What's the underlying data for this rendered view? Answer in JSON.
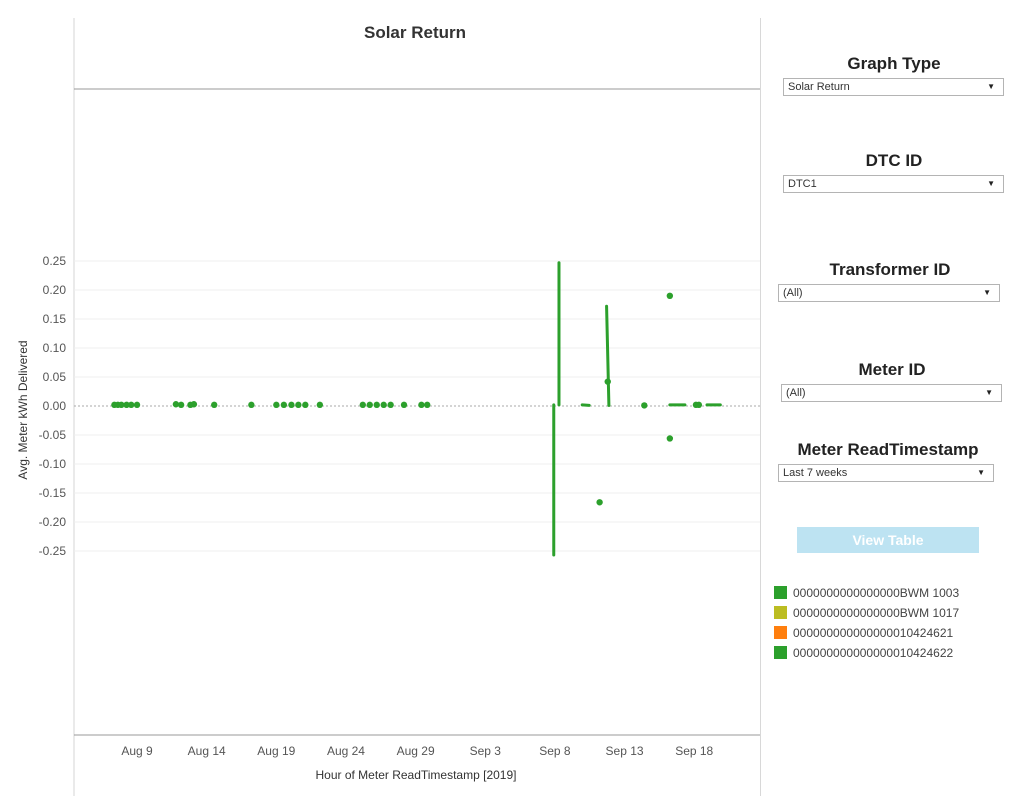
{
  "chart_data": {
    "type": "scatter",
    "title": "Solar Return",
    "xlabel": "Hour of Meter ReadTimestamp [2019]",
    "ylabel": "Avg. Meter kWh Delivered",
    "ylim": [
      -0.27,
      0.27
    ],
    "xlim": [
      "2019-08-05",
      "2019-09-23"
    ],
    "y_ticks": [
      "0.25",
      "0.20",
      "0.15",
      "0.10",
      "0.05",
      "0.00",
      "-0.05",
      "-0.10",
      "-0.15",
      "-0.20",
      "-0.25"
    ],
    "x_ticks": [
      {
        "label": "Aug 9",
        "date": "2019-08-09"
      },
      {
        "label": "Aug 14",
        "date": "2019-08-14"
      },
      {
        "label": "Aug 19",
        "date": "2019-08-19"
      },
      {
        "label": "Aug 24",
        "date": "2019-08-24"
      },
      {
        "label": "Aug 29",
        "date": "2019-08-29"
      },
      {
        "label": "Sep 3",
        "date": "2019-09-03"
      },
      {
        "label": "Sep 8",
        "date": "2019-09-08"
      },
      {
        "label": "Sep 13",
        "date": "2019-09-13"
      },
      {
        "label": "Sep 18",
        "date": "2019-09-18"
      }
    ],
    "grid": true,
    "series": [
      {
        "name": "0000000000000000BWM 1003",
        "color": "#2ca02c",
        "points": [
          {
            "x": "2019-08-07 09:00",
            "y": 0.002
          },
          {
            "x": "2019-08-07 15:00",
            "y": 0.002
          },
          {
            "x": "2019-08-07 21:00",
            "y": 0.002
          },
          {
            "x": "2019-08-08 06:00",
            "y": 0.002
          },
          {
            "x": "2019-08-08 14:00",
            "y": 0.002
          },
          {
            "x": "2019-08-09 00:00",
            "y": 0.002
          },
          {
            "x": "2019-08-11 19:00",
            "y": 0.003
          },
          {
            "x": "2019-08-12 04:00",
            "y": 0.002
          },
          {
            "x": "2019-08-12 20:00",
            "y": 0.002
          },
          {
            "x": "2019-08-13 02:00",
            "y": 0.003
          },
          {
            "x": "2019-08-14 13:00",
            "y": 0.002
          },
          {
            "x": "2019-08-17 05:00",
            "y": 0.002
          },
          {
            "x": "2019-08-19 00:00",
            "y": 0.002
          },
          {
            "x": "2019-08-19 13:00",
            "y": 0.002
          },
          {
            "x": "2019-08-20 02:00",
            "y": 0.002
          },
          {
            "x": "2019-08-20 14:00",
            "y": 0.002
          },
          {
            "x": "2019-08-21 02:00",
            "y": 0.002
          },
          {
            "x": "2019-08-22 03:00",
            "y": 0.002
          },
          {
            "x": "2019-08-25 05:00",
            "y": 0.002
          },
          {
            "x": "2019-08-25 17:00",
            "y": 0.002
          },
          {
            "x": "2019-08-26 05:00",
            "y": 0.002
          },
          {
            "x": "2019-08-26 17:00",
            "y": 0.002
          },
          {
            "x": "2019-08-27 05:00",
            "y": 0.002
          },
          {
            "x": "2019-08-28 04:00",
            "y": 0.002
          },
          {
            "x": "2019-08-29 10:00",
            "y": 0.002
          },
          {
            "x": "2019-08-29 20:00",
            "y": 0.002
          },
          {
            "x": "2019-09-11 19:00",
            "y": 0.042
          },
          {
            "x": "2019-09-11 05:00",
            "y": -0.166
          },
          {
            "x": "2019-09-14 10:00",
            "y": 0.001
          },
          {
            "x": "2019-09-16 06:00",
            "y": 0.19
          },
          {
            "x": "2019-09-16 06:00",
            "y": -0.056
          },
          {
            "x": "2019-09-18 03:00",
            "y": 0.002
          },
          {
            "x": "2019-09-18 08:00",
            "y": 0.002
          }
        ],
        "segments": [
          {
            "x1": "2019-09-07 22:00",
            "y1": 0.002,
            "x2": "2019-09-07 22:00",
            "y2": -0.257
          },
          {
            "x1": "2019-09-08 07:00",
            "y1": 0.247,
            "x2": "2019-09-08 07:00",
            "y2": 0.002
          },
          {
            "x1": "2019-09-09 23:00",
            "y1": 0.002,
            "x2": "2019-09-10 11:00",
            "y2": 0.001
          },
          {
            "x1": "2019-09-11 17:00",
            "y1": 0.172,
            "x2": "2019-09-11 21:00",
            "y2": 0.001
          },
          {
            "x1": "2019-09-16 06:00",
            "y1": 0.002,
            "x2": "2019-09-17 08:00",
            "y2": 0.002
          },
          {
            "x1": "2019-09-18 22:00",
            "y1": 0.002,
            "x2": "2019-09-19 21:00",
            "y2": 0.002
          }
        ]
      },
      {
        "name": "0000000000000000BWM 1017",
        "color": "#bcbd22",
        "points": []
      },
      {
        "name": "000000000000000010424621",
        "color": "#ff7f0e",
        "points": []
      },
      {
        "name": "000000000000000010424622",
        "color": "#2ca02c",
        "points": []
      }
    ]
  },
  "filters": {
    "graph_type": {
      "title": "Graph Type",
      "value": "Solar Return"
    },
    "dtc_id": {
      "title": "DTC ID",
      "value": "DTC1"
    },
    "transformer_id": {
      "title": "Transformer ID",
      "value": "(All)"
    },
    "meter_id": {
      "title": "Meter ID",
      "value": "(All)"
    },
    "meter_read_timestamp": {
      "title": "Meter ReadTimestamp",
      "value": "Last 7 weeks"
    }
  },
  "view_table_label": "View Table",
  "legend": {
    "items": [
      {
        "label": "0000000000000000BWM 1003",
        "color": "#2ca02c"
      },
      {
        "label": "0000000000000000BWM 1017",
        "color": "#bcbd22"
      },
      {
        "label": "000000000000000010424621",
        "color": "#ff7f0e"
      },
      {
        "label": "000000000000000010424622",
        "color": "#2ca02c"
      }
    ]
  },
  "icons": {
    "dropdown_caret": "caret-down-icon"
  }
}
